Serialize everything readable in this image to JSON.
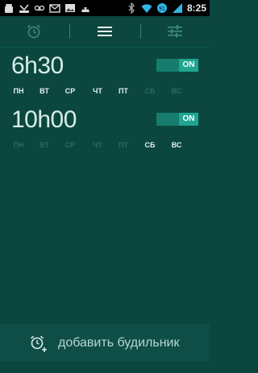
{
  "status_bar": {
    "time": "8:25",
    "icons": [
      "android-debug-icon",
      "missed-call-icon",
      "voicemail-icon",
      "gmail-icon",
      "image-icon",
      "cyanogen-icon",
      "bluetooth-icon",
      "wifi-icon",
      "battery-saver-icon",
      "signal-icon"
    ]
  },
  "action_bar": {
    "alarms_tab_icon": "alarm-clock-icon",
    "list_tab_icon": "menu-icon",
    "settings_tab_icon": "sliders-icon"
  },
  "alarms": [
    {
      "time": "6h30",
      "toggle_label": "ON",
      "days": [
        {
          "label": "ПН",
          "active": true
        },
        {
          "label": "ВТ",
          "active": true
        },
        {
          "label": "СР",
          "active": true
        },
        {
          "label": "ЧТ",
          "active": true
        },
        {
          "label": "ПТ",
          "active": true
        },
        {
          "label": "СБ",
          "active": false
        },
        {
          "label": "ВС",
          "active": false
        }
      ]
    },
    {
      "time": "10h00",
      "toggle_label": "ON",
      "days": [
        {
          "label": "ПН",
          "active": false
        },
        {
          "label": "ВТ",
          "active": false
        },
        {
          "label": "СР",
          "active": false
        },
        {
          "label": "ЧТ",
          "active": false
        },
        {
          "label": "ПТ",
          "active": false
        },
        {
          "label": "СБ",
          "active": true
        },
        {
          "label": "ВС",
          "active": true
        }
      ]
    }
  ],
  "add_alarm": {
    "label": "добавить будильник",
    "icon": "add-alarm-icon"
  },
  "colors": {
    "background": "#0b473f",
    "accent": "#1fa590",
    "day_active": "#e4f1ef",
    "day_inactive": "#2c6a61"
  }
}
